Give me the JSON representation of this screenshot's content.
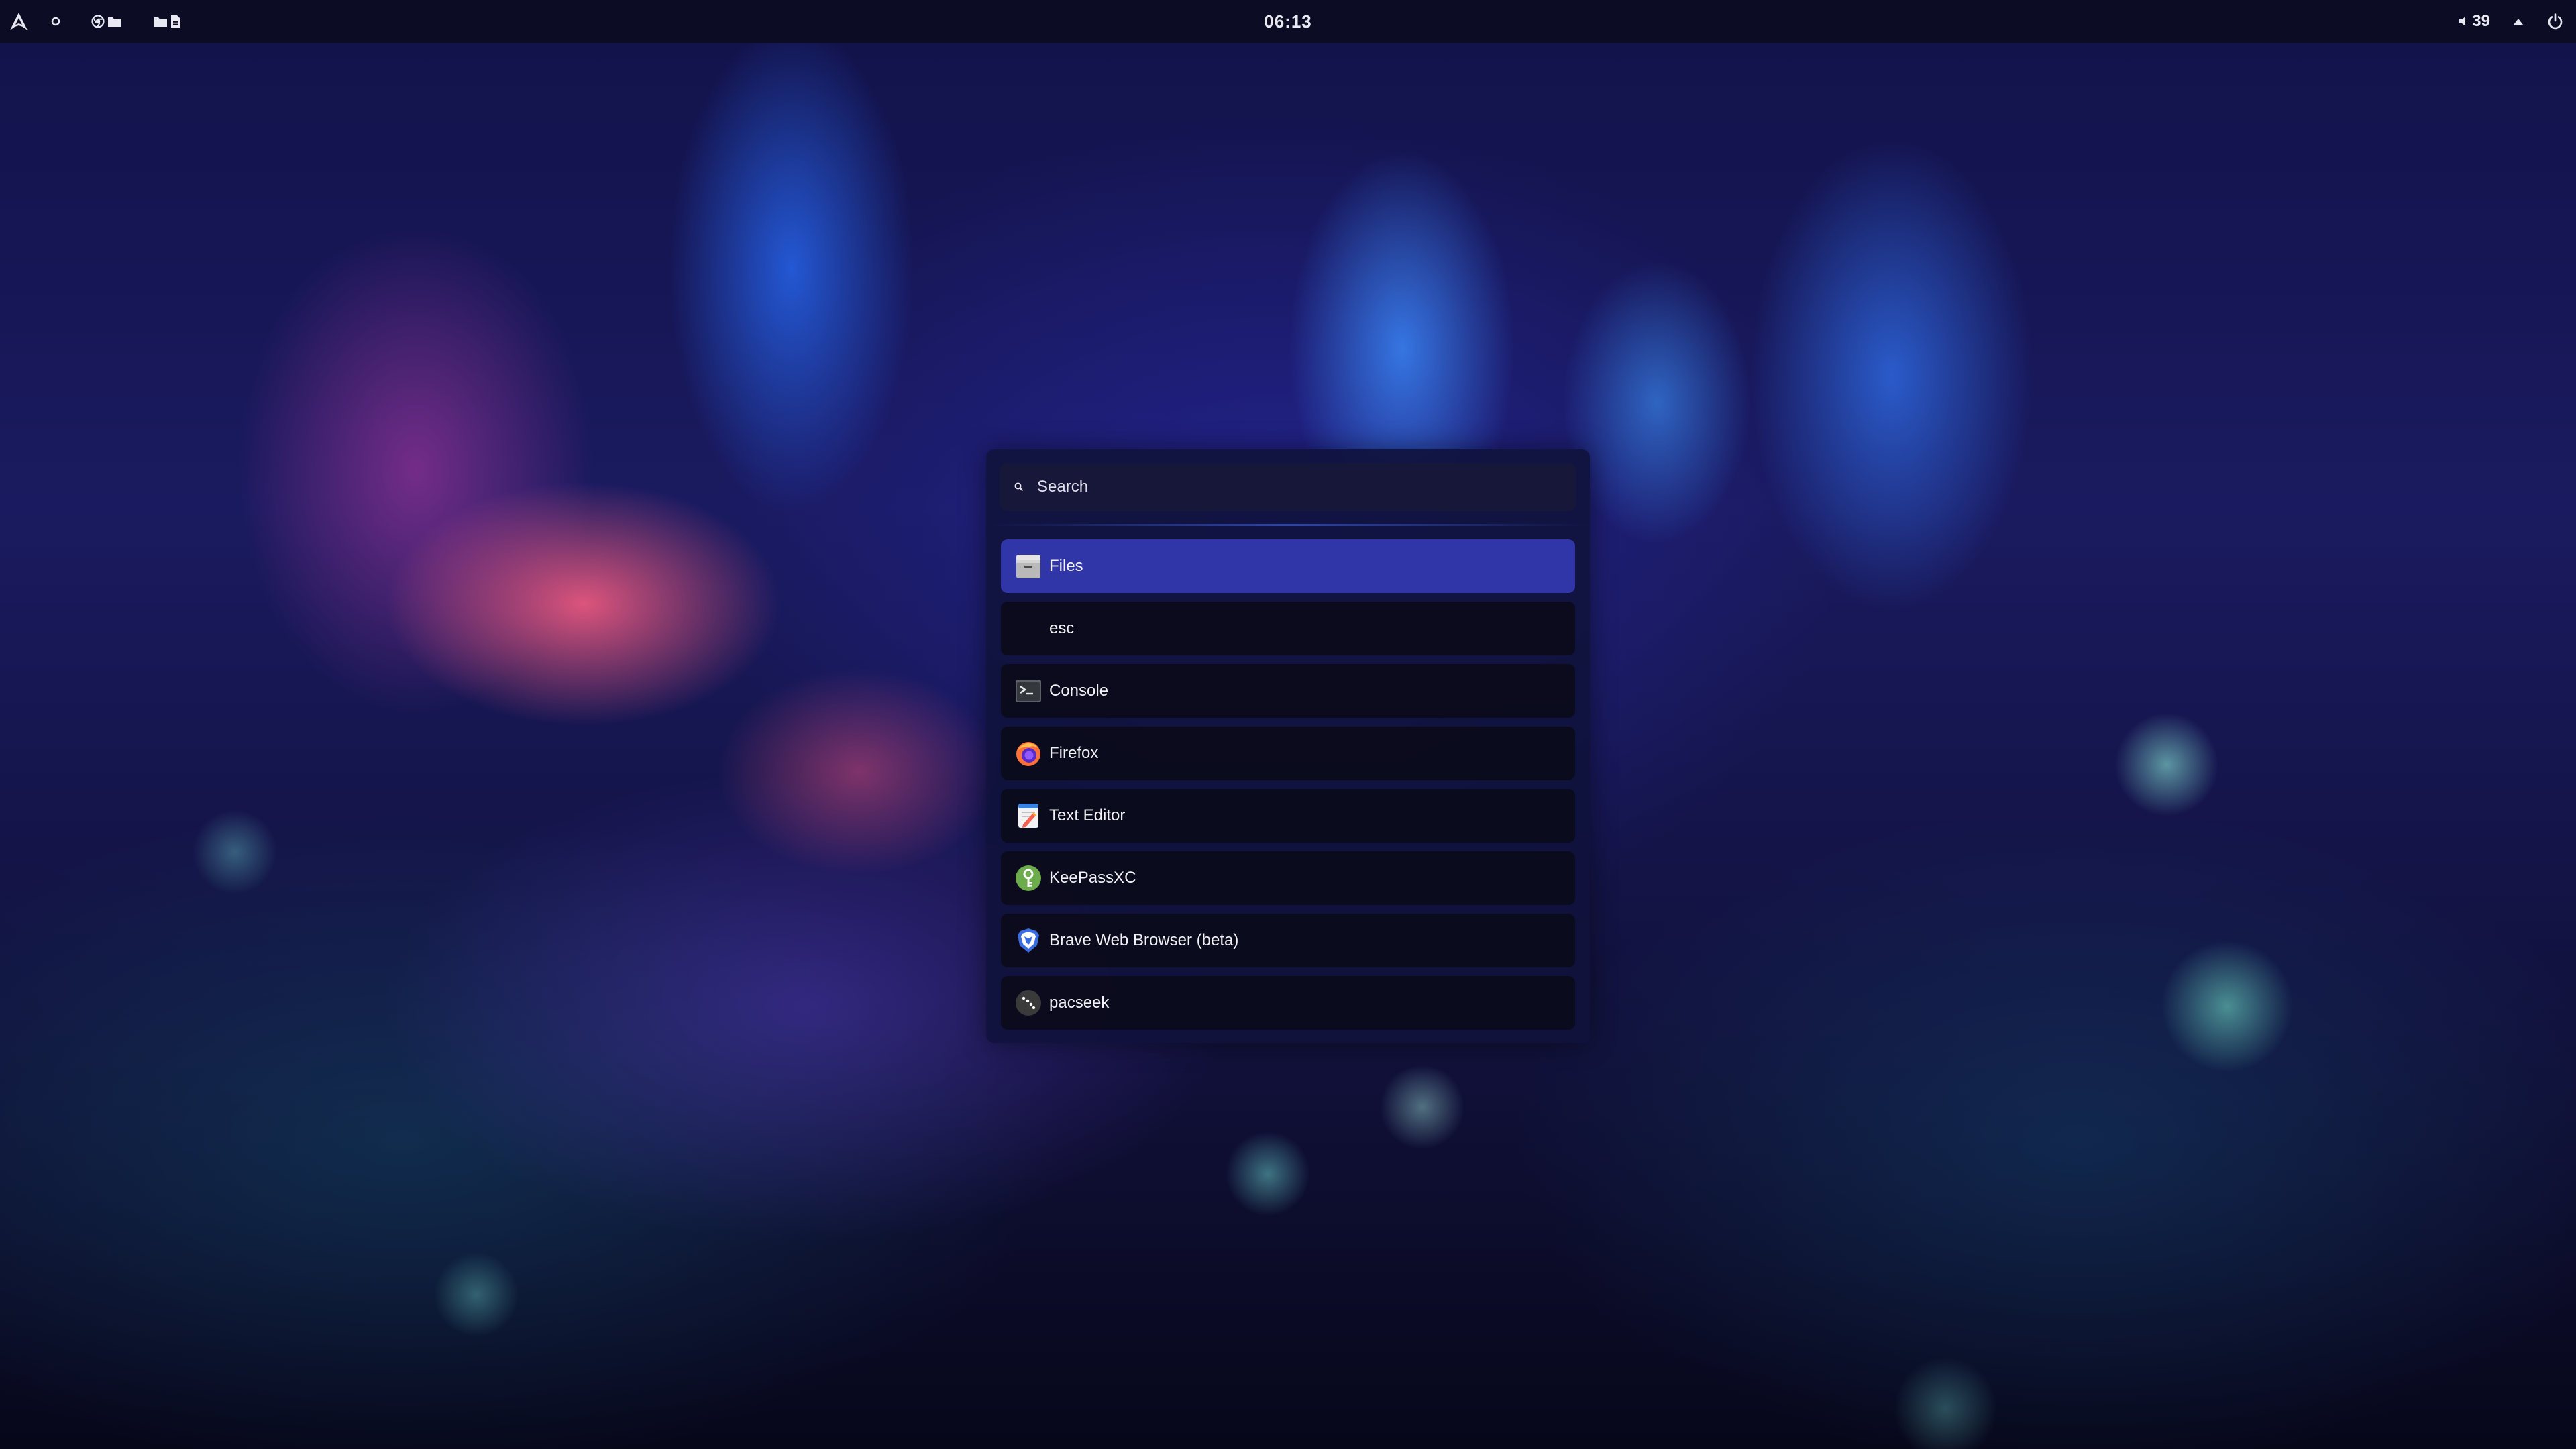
{
  "topbar": {
    "clock": "06:13",
    "volume": "39",
    "icons": [
      "arch-logo-icon",
      "workspace-dot-icon",
      "chrome-icon",
      "folder-icon",
      "folder-icon",
      "document-icon",
      "volume-icon",
      "tray-icon",
      "power-icon"
    ]
  },
  "launcher": {
    "search": {
      "placeholder": "Search",
      "value": ""
    },
    "results": [
      {
        "label": "Files",
        "icon": "files-icon",
        "selected": true
      },
      {
        "label": "esc",
        "icon": "",
        "selected": false
      },
      {
        "label": "Console",
        "icon": "console-icon",
        "selected": false
      },
      {
        "label": "Firefox",
        "icon": "firefox-icon",
        "selected": false
      },
      {
        "label": "Text Editor",
        "icon": "text-editor-icon",
        "selected": false
      },
      {
        "label": "KeePassXC",
        "icon": "keepassxc-icon",
        "selected": false
      },
      {
        "label": "Brave Web Browser (beta)",
        "icon": "brave-icon",
        "selected": false
      },
      {
        "label": "pacseek",
        "icon": "pacseek-icon",
        "selected": false
      }
    ]
  },
  "colors": {
    "topbar_bg": "#0c0c24",
    "launcher_bg": "#10123c",
    "selected_row": "#3035a8",
    "row_bg": "#0a0a16"
  }
}
